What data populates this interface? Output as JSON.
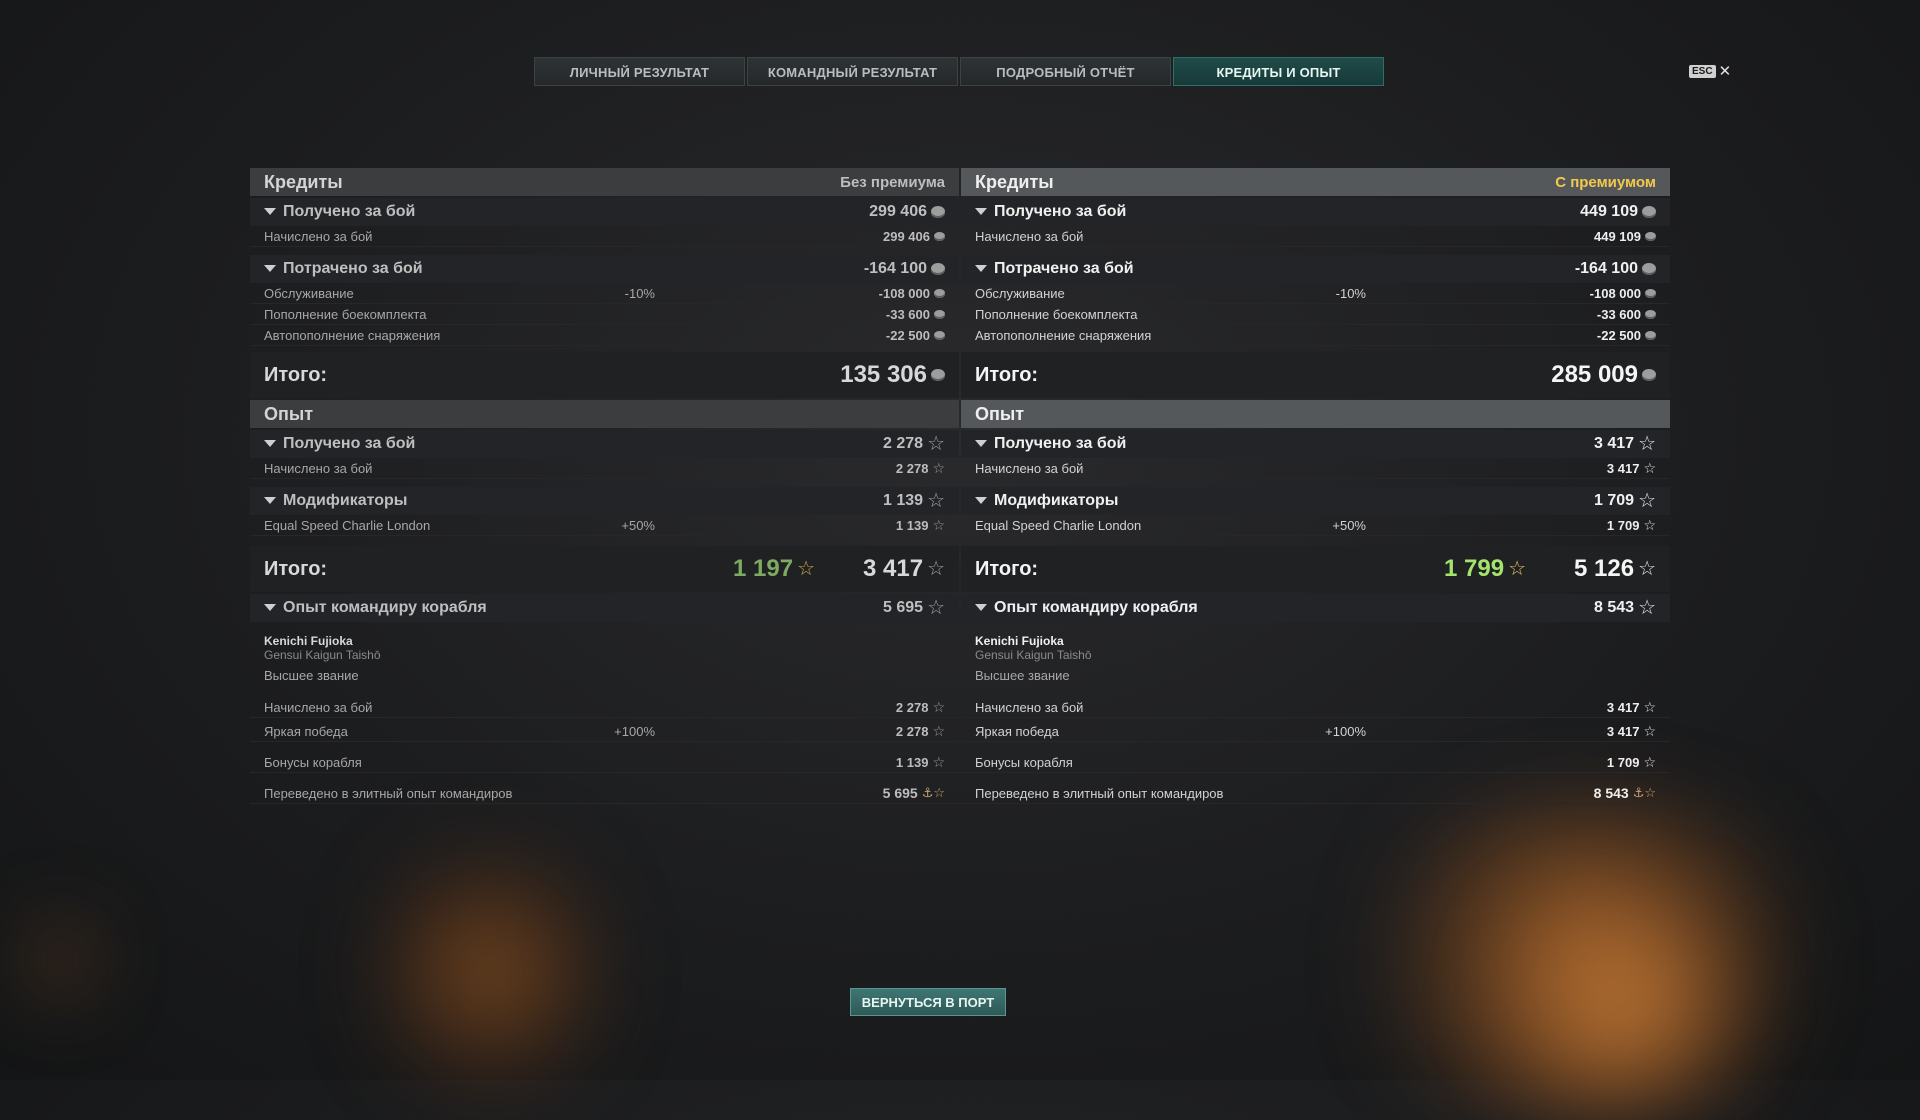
{
  "tabs": [
    {
      "label": "ЛИЧНЫЙ РЕЗУЛЬТАТ"
    },
    {
      "label": "КОМАНДНЫЙ РЕЗУЛЬТАТ"
    },
    {
      "label": "ПОДРОБНЫЙ ОТЧЁТ"
    },
    {
      "label": "КРЕДИТЫ И ОПЫТ"
    }
  ],
  "esc": {
    "key": "ESC",
    "close": "✕"
  },
  "left": {
    "credits_title": "Кредиты",
    "credits_sub": "Без премиума",
    "earned_label": "Получено за бой",
    "earned_val": "299 406",
    "accrued_label": "Начислено за бой",
    "accrued_val": "299 406",
    "spent_label": "Потрачено за бой",
    "spent_val": "-164 100",
    "service_label": "Обслуживание",
    "service_pct": "-10%",
    "service_val": "-108 000",
    "ammo_label": "Пополнение боекомплекта",
    "ammo_val": "-33 600",
    "equip_label": "Автопополнение снаряжения",
    "equip_val": "-22 500",
    "total_label": "Итого:",
    "total_val": "135 306",
    "xp_title": "Опыт",
    "xp_earned_label": "Получено за бой",
    "xp_earned_val": "2 278",
    "xp_accrued_label": "Начислено за бой",
    "xp_accrued_val": "2 278",
    "mods_label": "Модификаторы",
    "mods_val": "1 139",
    "flag_label": "Equal Speed Charlie London",
    "flag_pct": "+50%",
    "flag_val": "1 139",
    "xp_total_label": "Итого:",
    "xp_total_green": "1 197",
    "xp_total_val": "3 417",
    "cmdr_label": "Опыт командиру корабля",
    "cmdr_val": "5 695",
    "cmdr_name": "Kenichi Fujioka",
    "cmdr_rank": "Gensui Kaigun Taishō",
    "cmdr_title": "Высшее звание",
    "c_accrued_label": "Начислено за бой",
    "c_accrued_val": "2 278",
    "c_win_label": "Яркая победа",
    "c_win_pct": "+100%",
    "c_win_val": "2 278",
    "c_ship_label": "Бонусы корабля",
    "c_ship_val": "1 139",
    "c_elite_label": "Переведено в элитный опыт командиров",
    "c_elite_val": "5 695"
  },
  "right": {
    "credits_title": "Кредиты",
    "credits_sub": "С премиумом",
    "earned_label": "Получено за бой",
    "earned_val": "449 109",
    "accrued_label": "Начислено за бой",
    "accrued_val": "449 109",
    "spent_label": "Потрачено за бой",
    "spent_val": "-164 100",
    "service_label": "Обслуживание",
    "service_pct": "-10%",
    "service_val": "-108 000",
    "ammo_label": "Пополнение боекомплекта",
    "ammo_val": "-33 600",
    "equip_label": "Автопополнение снаряжения",
    "equip_val": "-22 500",
    "total_label": "Итого:",
    "total_val": "285 009",
    "xp_title": "Опыт",
    "xp_earned_label": "Получено за бой",
    "xp_earned_val": "3 417",
    "xp_accrued_label": "Начислено за бой",
    "xp_accrued_val": "3 417",
    "mods_label": "Модификаторы",
    "mods_val": "1 709",
    "flag_label": "Equal Speed Charlie London",
    "flag_pct": "+50%",
    "flag_val": "1 709",
    "xp_total_label": "Итого:",
    "xp_total_green": "1 799",
    "xp_total_val": "5 126",
    "cmdr_label": "Опыт командиру корабля",
    "cmdr_val": "8 543",
    "cmdr_name": "Kenichi Fujioka",
    "cmdr_rank": "Gensui Kaigun Taishō",
    "cmdr_title": "Высшее звание",
    "c_accrued_label": "Начислено за бой",
    "c_accrued_val": "3 417",
    "c_win_label": "Яркая победа",
    "c_win_pct": "+100%",
    "c_win_val": "3 417",
    "c_ship_label": "Бонусы корабля",
    "c_ship_val": "1 709",
    "c_elite_label": "Переведено в элитный опыт командиров",
    "c_elite_val": "8 543"
  },
  "back_button": "ВЕРНУТЬСЯ В ПОРТ",
  "colors": {
    "accent": "#1f4b49",
    "premium": "#f2c94c",
    "green": "#a5e46c"
  }
}
